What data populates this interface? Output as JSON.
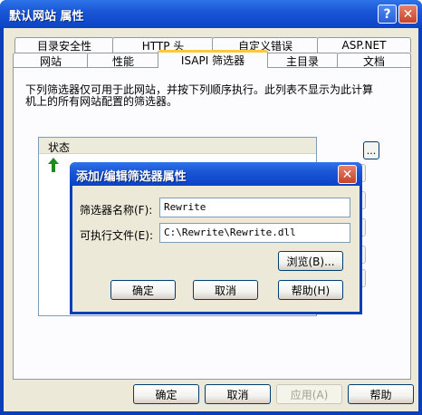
{
  "window": {
    "title": "默认网站 属性",
    "help_glyph": "?",
    "close_glyph": "✕"
  },
  "tabs_row1": [
    "目录安全性",
    "HTTP 头",
    "自定义错误",
    "ASP.NET"
  ],
  "tabs_row2": [
    "网站",
    "性能",
    "ISAPI 筛选器",
    "主目录",
    "文档"
  ],
  "active_tab": "ISAPI 筛选器",
  "panel": {
    "description_line1": "下列筛选器仅可用于此网站，并按下列顺序执行。此列表不显示为此计算",
    "description_line2": "机上的所有网站配置的筛选器。",
    "list_header_status": "状态",
    "side_top_button": "..."
  },
  "dialog": {
    "title": "添加/编辑筛选器属性",
    "close_glyph": "✕",
    "name_label": "筛选器名称(F):",
    "name_value": "Rewrite",
    "exe_label": "可执行文件(E):",
    "exe_value": "C:\\Rewrite\\Rewrite.dll",
    "browse_label": "浏览(B)...",
    "ok_label": "确定",
    "cancel_label": "取消",
    "help_label": "帮助(H)"
  },
  "footer": {
    "ok_label": "确定",
    "cancel_label": "取消",
    "apply_label": "应用(A)",
    "help_label": "帮助"
  },
  "colors": {
    "titlebar": "#1a56d6",
    "active_tab_accent": "#ffc83c",
    "arrow_green": "#1f8a1f"
  }
}
